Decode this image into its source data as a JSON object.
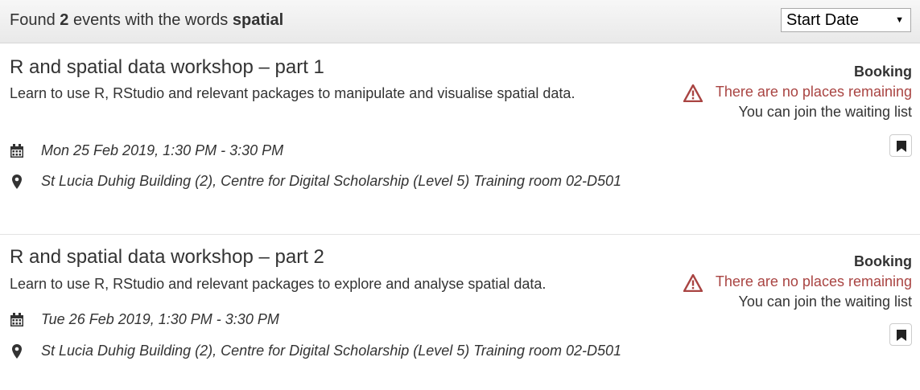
{
  "header": {
    "found_prefix": "Found",
    "count": "2",
    "middle": "events with the words",
    "keyword": "spatial"
  },
  "sort": {
    "selected": "Start Date"
  },
  "events": [
    {
      "title": "R and spatial data workshop – part 1",
      "description": "Learn to use R, RStudio and relevant packages to manipulate and visualise spatial data.",
      "date": "Mon 25 Feb 2019, 1:30 PM - 3:30 PM",
      "location": "St Lucia Duhig Building (2), Centre for Digital Scholarship (Level 5) Training room 02-D501",
      "booking_label": "Booking",
      "availability": "There are no places remaining",
      "waiting": "You can join the waiting list"
    },
    {
      "title": "R and spatial data workshop – part 2",
      "description": "Learn to use R, RStudio and relevant packages to explore and analyse spatial data.",
      "date": "Tue 26 Feb 2019, 1:30 PM - 3:30 PM",
      "location": "St Lucia Duhig Building (2), Centre for Digital Scholarship (Level 5) Training room 02-D501",
      "booking_label": "Booking",
      "availability": "There are no places remaining",
      "waiting": "You can join the waiting list"
    }
  ],
  "icons": {
    "date": "calendar-icon",
    "location": "map-marker-icon",
    "warning": "warning-icon",
    "bookmark": "bookmark-icon"
  },
  "colors": {
    "warning_text": "#a94442"
  }
}
